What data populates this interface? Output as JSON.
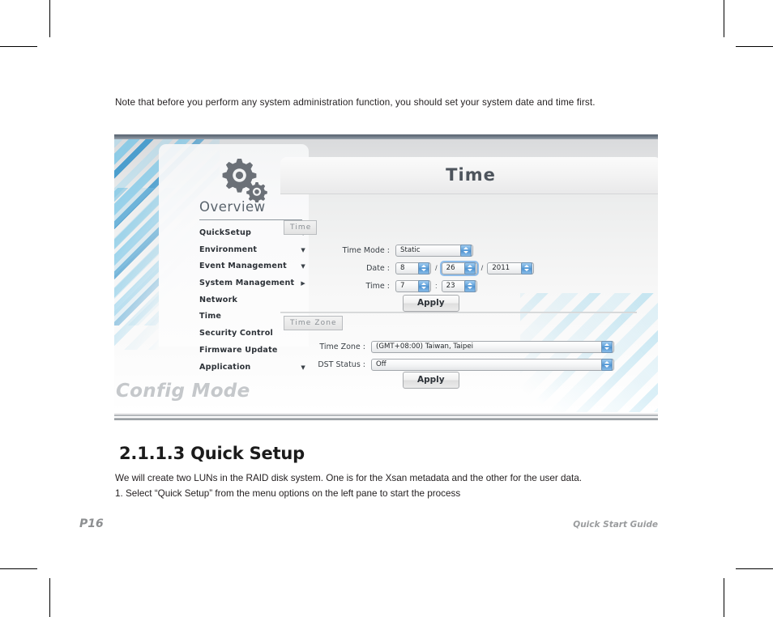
{
  "page": {
    "intro_note": "Note that before you perform any system administration function, you should set your system date and time first.",
    "section_heading": "2.1.1.3 Quick Setup",
    "paragraph_1": "We will create two LUNs in the RAID disk system. One is for the Xsan metadata and the other for the user data.",
    "paragraph_2": "1.  Select “Quick Setup” from the menu options on the left pane to start the process",
    "footer_page": "P16",
    "footer_guide": "Quick Start Guide"
  },
  "figure": {
    "sidebar": {
      "icon": "gears-icon",
      "title": "Overview",
      "items": [
        {
          "label": "QuickSetup",
          "arrow": "▼"
        },
        {
          "label": "Environment",
          "arrow": "▼"
        },
        {
          "label": "Event Management",
          "arrow": "▼"
        },
        {
          "label": "System Management",
          "arrow": "▶"
        },
        {
          "label": "Network",
          "arrow": ""
        },
        {
          "label": "Time",
          "arrow": ""
        },
        {
          "label": "Security Control",
          "arrow": ""
        },
        {
          "label": "Firmware Update",
          "arrow": ""
        },
        {
          "label": "Application",
          "arrow": "▼"
        }
      ],
      "mode_watermark": "Config Mode"
    },
    "content": {
      "header_title": "Time",
      "time_section": {
        "tab_label": "Time",
        "fields": [
          {
            "label": "Time Mode :",
            "value": "Static"
          }
        ],
        "date_label": "Date :",
        "date_month": "8",
        "date_day": "26",
        "date_year": "2011",
        "date_sep": "/",
        "time_label": "Time :",
        "time_hour": "7",
        "time_minute": "23",
        "time_sep": ":",
        "apply_label": "Apply"
      },
      "timezone_section": {
        "tab_label": "Time Zone",
        "timezone_label": "Time Zone :",
        "timezone_value": "(GMT+08:00) Taiwan, Taipei",
        "dst_label": "DST Status :",
        "dst_value": "Off",
        "apply_label": "Apply"
      }
    }
  },
  "colors": {
    "accent_blue": "#2b8cc8",
    "stepper_blue": "#5c9fd9",
    "header_text": "#4d545c",
    "watermark_gray": "#c5c8cb"
  }
}
